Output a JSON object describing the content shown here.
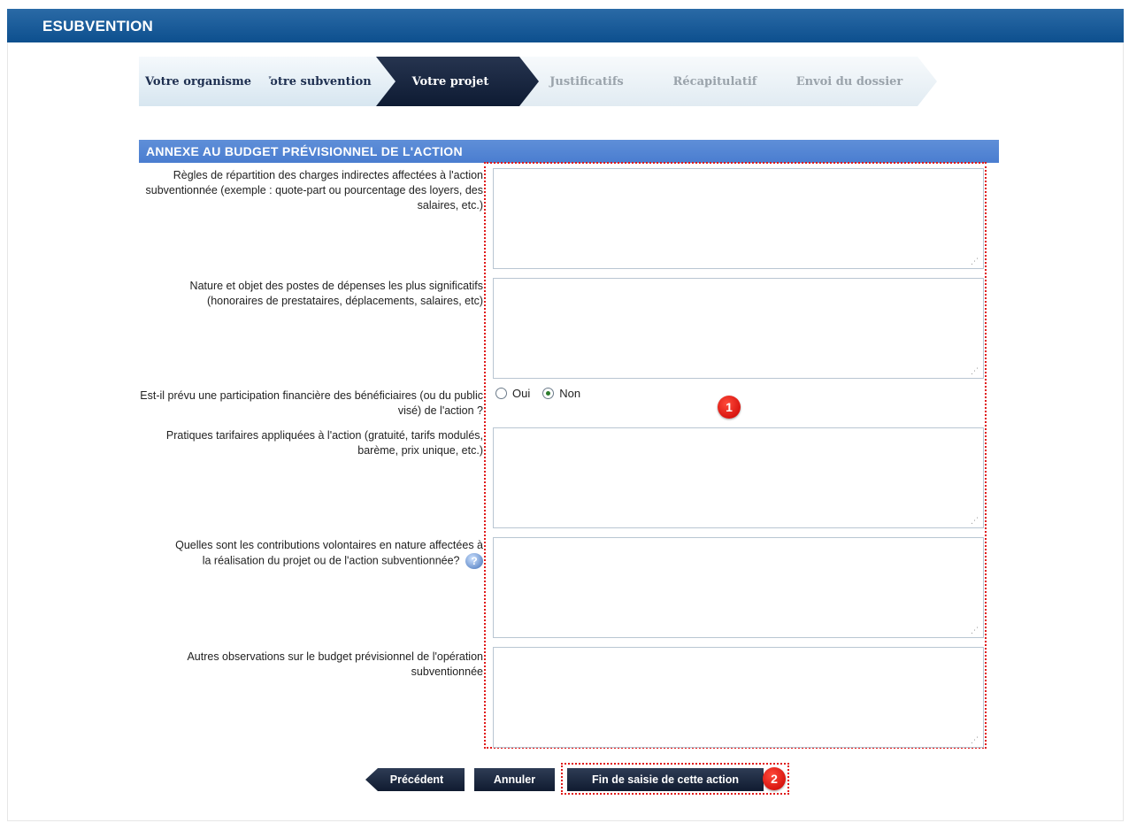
{
  "app": {
    "title": "ESUBVENTION"
  },
  "steps": [
    {
      "label": "Votre organisme",
      "state": "done"
    },
    {
      "label": "Votre subvention",
      "state": "done"
    },
    {
      "label": "Votre projet",
      "state": "active"
    },
    {
      "label": "Justificatifs",
      "state": "future"
    },
    {
      "label": "Récapitulatif",
      "state": "future"
    },
    {
      "label": "Envoi du dossier",
      "state": "future"
    }
  ],
  "section": {
    "title": "ANNEXE AU BUDGET PRÉVISIONNEL DE L'ACTION"
  },
  "fields": {
    "regles": {
      "label": "Règles de répartition des charges indirectes affectées à l'action subventionnée (exemple : quote-part ou pourcentage des loyers, des salaires, etc.)",
      "value": ""
    },
    "nature": {
      "label": "Nature et objet des postes de dépenses les plus significatifs (honoraires de prestataires, déplacements, salaires, etc)",
      "value": ""
    },
    "participation": {
      "label": "Est-il prévu une participation financière des bénéficiaires (ou du public visé) de l'action ?",
      "options": [
        "Oui",
        "Non"
      ],
      "selected": "Non"
    },
    "pratiques": {
      "label": "Pratiques tarifaires appliquées à l'action (gratuité, tarifs modulés, barème, prix unique, etc.)",
      "value": ""
    },
    "contributions": {
      "label": "Quelles sont les contributions volontaires en nature affectées à la réalisation du projet ou de l'action subventionnée?",
      "value": ""
    },
    "autres": {
      "label": "Autres observations sur le budget prévisionnel de l'opération subventionnée",
      "value": ""
    }
  },
  "badges": {
    "one": "1",
    "two": "2"
  },
  "buttons": {
    "previous": "Précédent",
    "cancel": "Annuler",
    "finish": "Fin de saisie de cette action"
  },
  "icons": {
    "help": "?"
  },
  "colors": {
    "topbar": "#0d4f8e",
    "section_header": "#4a7dd0",
    "active_step": "#0e1b33",
    "annotation_red": "#e01a1a"
  }
}
